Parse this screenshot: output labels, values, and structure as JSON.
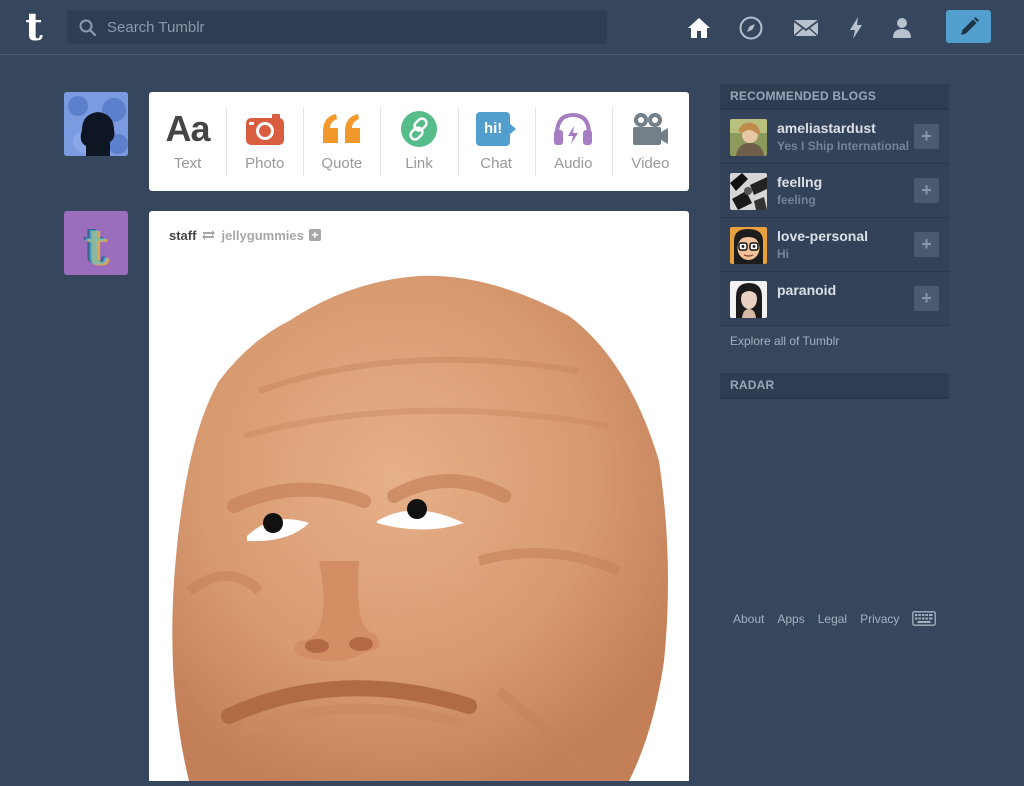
{
  "header": {
    "logo_text": "t",
    "search_placeholder": "Search Tumblr",
    "nav_icons": [
      "home-icon",
      "explore-compass-icon",
      "inbox-envelope-icon",
      "activity-bolt-icon",
      "account-person-icon"
    ],
    "compose_icon": "pencil-icon",
    "accent_color": "#529ecc",
    "background_color": "#36465d"
  },
  "post_types": [
    {
      "label": "Text",
      "glyph": "Aa",
      "color": "#444444"
    },
    {
      "label": "Photo",
      "color": "#d95e40"
    },
    {
      "label": "Quote",
      "glyph": "❝",
      "color": "#f2992e"
    },
    {
      "label": "Link",
      "color": "#56bc8a"
    },
    {
      "label": "Chat",
      "glyph": "hi!",
      "color": "#529ecc"
    },
    {
      "label": "Audio",
      "color": "#a77dc2"
    },
    {
      "label": "Video",
      "color": "#748089"
    }
  ],
  "post": {
    "author": "staff",
    "source": "jellygummies",
    "follow_glyph": "+"
  },
  "sidebar": {
    "recommended_title": "RECOMMENDED BLOGS",
    "blogs": [
      {
        "name": "ameliastardust",
        "subtitle": "Yes I Ship International"
      },
      {
        "name": "feellng",
        "subtitle": "feeling"
      },
      {
        "name": "love-personal",
        "subtitle": "Hi"
      },
      {
        "name": "paranoid",
        "subtitle": ""
      }
    ],
    "follow_glyph": "+",
    "explore_label": "Explore all of Tumblr",
    "radar_title": "RADAR"
  },
  "footer": {
    "about": "About",
    "apps": "Apps",
    "legal": "Legal",
    "privacy": "Privacy",
    "keyboard_icon": "keyboard-icon"
  }
}
